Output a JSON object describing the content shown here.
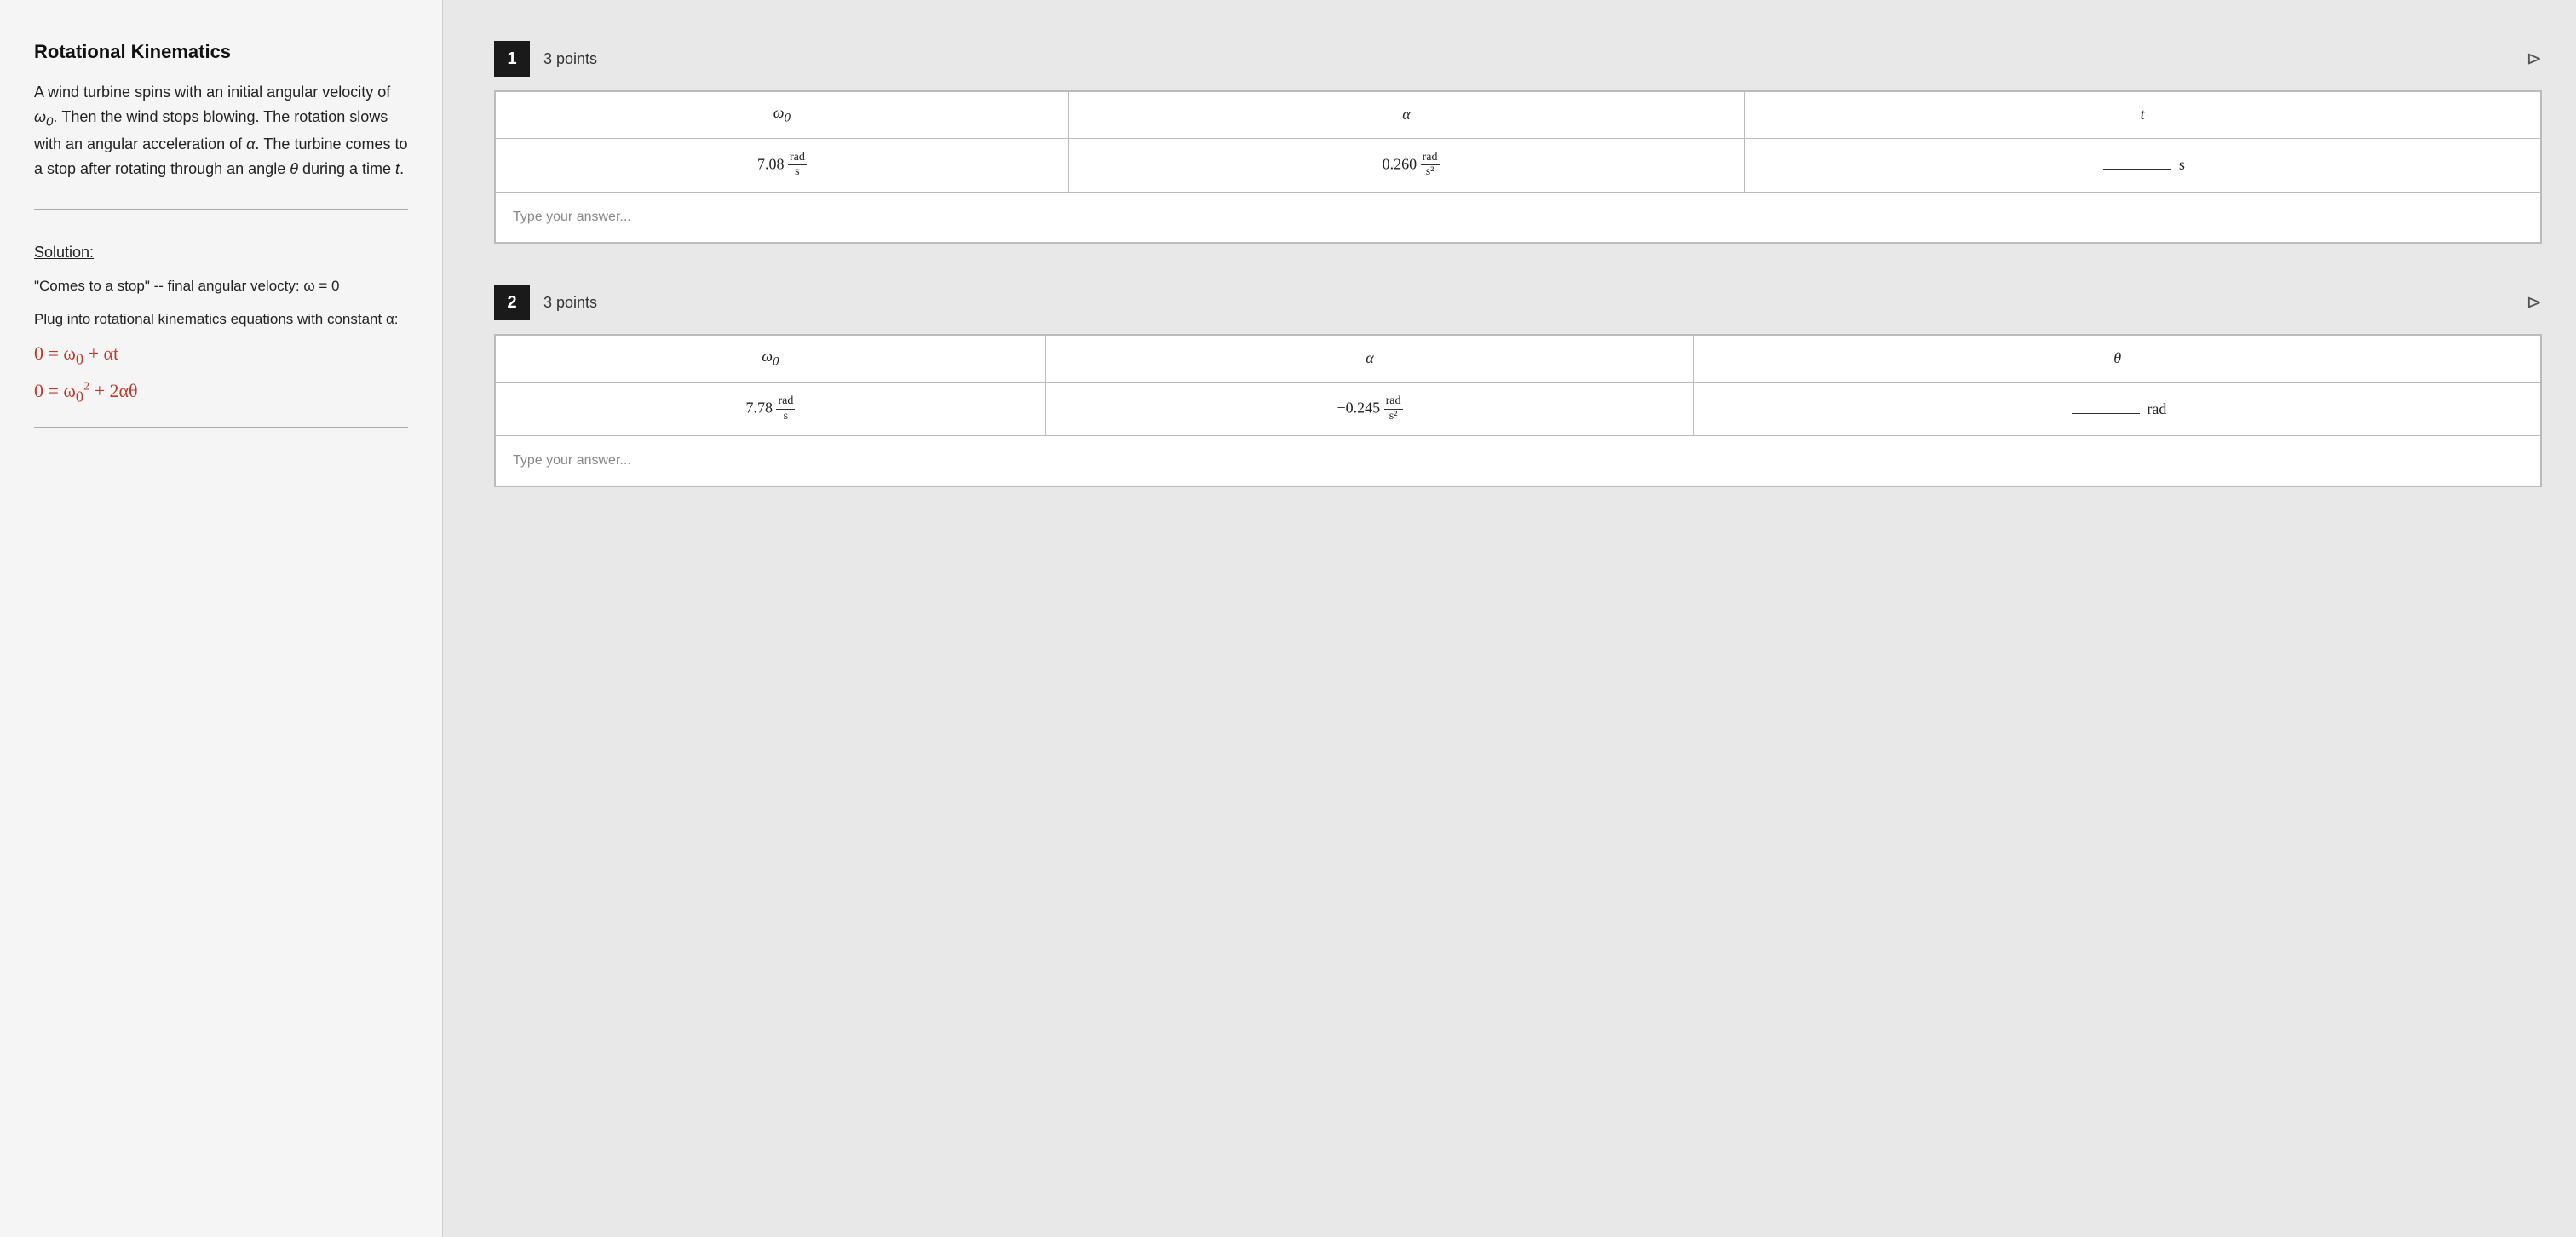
{
  "left": {
    "title": "Rotational Kinematics",
    "problem_text": "A wind turbine spins with an initial angular velocity of ω₀. Then the wind stops blowing. The rotation slows with an angular acceleration of α. The turbine comes to a stop after rotating through an angle θ during a time t.",
    "solution_label": "Solution:",
    "solution_line1": "\"Comes to a stop\" -- final angular velocty: ω = 0",
    "solution_line2": "Plug into rotational kinematics equations with constant α:",
    "equation1": "0 = ω₀ + αt",
    "equation2": "0 = ω₀² + 2αθ"
  },
  "right": {
    "questions": [
      {
        "number": "1",
        "points": "3 points",
        "columns": [
          "ω₀",
          "α",
          "t"
        ],
        "values": [
          "7.08 rad/s",
          "-0.260 rad/s²",
          "_____ s"
        ],
        "answer_placeholder": "Type your answer...",
        "pin_icon": "📌"
      },
      {
        "number": "2",
        "points": "3 points",
        "columns": [
          "ω₀",
          "α",
          "θ"
        ],
        "values": [
          "7.78 rad/s",
          "-0.245 rad/s²",
          "_____ rad"
        ],
        "answer_placeholder": "Type your answer...",
        "pin_icon": "📌"
      }
    ]
  }
}
